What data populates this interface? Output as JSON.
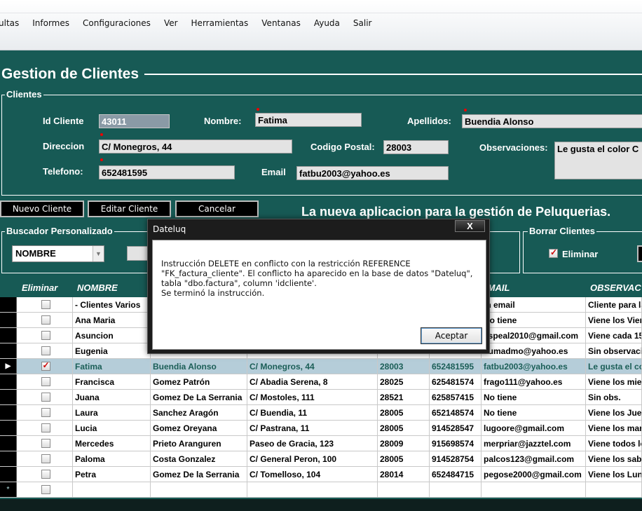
{
  "menu": [
    "ultas",
    "Informes",
    "Configuraciones",
    "Ver",
    "Herramientas",
    "Ventanas",
    "Ayuda",
    "Salir"
  ],
  "page_title": "Gestion de Clientes",
  "clientes_group": {
    "label": "Clientes",
    "id_label": "Id Cliente",
    "id_value": "43011",
    "nombre_label": "Nombre:",
    "nombre_value": "Fatima",
    "apellidos_label": "Apellidos:",
    "apellidos_value": "Buendia Alonso",
    "direccion_label": "Direccion",
    "direccion_value": "C/ Monegros, 44",
    "cp_label": "Codigo Postal:",
    "cp_value": "28003",
    "obs_label": "Observaciones:",
    "obs_value": "Le gusta el color C",
    "telefono_label": "Telefono:",
    "telefono_value": "652481595",
    "email_label": "Email",
    "email_value": "fatbu2003@yahoo.es"
  },
  "buttons": {
    "nuevo": "Nuevo Cliente",
    "editar": "Editar Cliente",
    "cancelar": "Cancelar"
  },
  "tagline": "La nueva aplicacion para la gestión de Peluquerias.",
  "buscador": {
    "label": "Buscador Personalizado",
    "combo_value": "NOMBRE"
  },
  "borrar": {
    "label": "Borrar Clientes",
    "checkbox_label": "Eliminar"
  },
  "grid": {
    "headers": [
      "Eliminar",
      "NOMBRE",
      "",
      "",
      "",
      "",
      "EMAIL",
      "OBSERVAC"
    ],
    "rows": [
      {
        "nombre": "- Clientes Varios",
        "apellidos": "",
        "direccion": "",
        "cp": "",
        "tel": "",
        "email": "in email",
        "obs": "Cliente para la"
      },
      {
        "nombre": "Ana Maria",
        "apellidos": "",
        "direccion": "",
        "cp": "",
        "tel": "",
        "email": "No tiene",
        "obs": "Viene los Vier"
      },
      {
        "nombre": "Asuncion",
        "apellidos": "",
        "direccion": "",
        "cp": "",
        "tel": "",
        "email": "aspeal2010@gmail.com",
        "obs": "Viene cada 15"
      },
      {
        "nombre": "Eugenia",
        "apellidos": "",
        "direccion": "",
        "cp": "",
        "tel": "",
        "email": "eumadmo@yahoo.es",
        "obs": "Sin observacio"
      },
      {
        "nombre": "Fatima",
        "apellidos": "Buendia Alonso",
        "direccion": "C/ Monegros, 44",
        "cp": "28003",
        "tel": "652481595",
        "email": "fatbu2003@yahoo.es",
        "obs": "Le gusta el co"
      },
      {
        "nombre": "Francisca",
        "apellidos": "Gomez Patrón",
        "direccion": "C/ Abadia Serena, 8",
        "cp": "28025",
        "tel": "625481574",
        "email": "frago111@yahoo.es",
        "obs": "Viene los mier"
      },
      {
        "nombre": "Juana",
        "apellidos": "Gomez De La Serrania",
        "direccion": "C/ Mostoles, 111",
        "cp": "28521",
        "tel": "625857415",
        "email": "No tiene",
        "obs": "Sin obs."
      },
      {
        "nombre": "Laura",
        "apellidos": "Sanchez Aragón",
        "direccion": "C/ Buendia, 11",
        "cp": "28005",
        "tel": "652148574",
        "email": "No tiene",
        "obs": "Viene los Jue"
      },
      {
        "nombre": "Lucia",
        "apellidos": "Gomez Oreyana",
        "direccion": "C/ Pastrana, 11",
        "cp": "28005",
        "tel": "914528547",
        "email": "lugoore@gmail.com",
        "obs": "Viene los mar"
      },
      {
        "nombre": "Mercedes",
        "apellidos": "Prieto Aranguren",
        "direccion": "Paseo de Gracia, 123",
        "cp": "28009",
        "tel": "915698574",
        "email": "merpriar@jazztel.com",
        "obs": "Viene todos lo"
      },
      {
        "nombre": "Paloma",
        "apellidos": "Costa Gonzalez",
        "direccion": "C/ General Peron, 100",
        "cp": "28005",
        "tel": "914528754",
        "email": "palcos123@gmail.com",
        "obs": "Viene los sab"
      },
      {
        "nombre": "Petra",
        "apellidos": "Gomez De la Serrania",
        "direccion": "C/ Tomelloso, 104",
        "cp": "28014",
        "tel": "652484715",
        "email": "pegose2000@gmail.com",
        "obs": "Viene los Lun"
      }
    ]
  },
  "dialog": {
    "title": "Dateluq",
    "close": "X",
    "message": "Instrucción DELETE en conflicto con la restricción REFERENCE\n\"FK_factura_cliente\". El conflicto ha aparecido en la base de datos \"Dateluq\",\ntabla \"dbo.factura\", column 'idcliente'.\nSe terminó la instrucción.",
    "ok": "Aceptar"
  },
  "colors": {
    "panel": "#175a55",
    "selected_row": "#b5cdd9",
    "required": "#e00000"
  }
}
